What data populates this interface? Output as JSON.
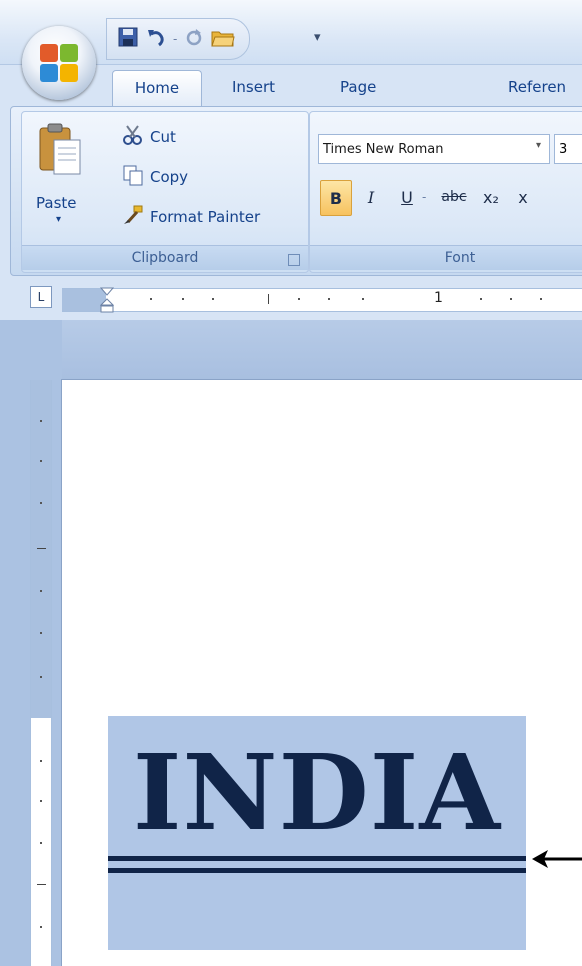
{
  "quick_access": {
    "icons": [
      "save-icon",
      "undo-icon",
      "redo-icon",
      "open-folder-icon"
    ],
    "customize_glyph": "▾"
  },
  "tabs": [
    {
      "label": "Home",
      "active": true
    },
    {
      "label": "Insert",
      "active": false
    },
    {
      "label": "Page Layout",
      "active": false
    },
    {
      "label": "Referen",
      "active": false
    }
  ],
  "clipboard": {
    "paste_label": "Paste",
    "cut_label": "Cut",
    "copy_label": "Copy",
    "format_painter_label": "Format Painter",
    "group_label": "Clipboard"
  },
  "font": {
    "font_name": "Times New Roman",
    "font_size": "3",
    "group_label": "Font",
    "buttons": [
      "B",
      "I",
      "U",
      "abc",
      "x₂",
      "x"
    ]
  },
  "ruler": {
    "number": "1",
    "tab_selector": "L"
  },
  "document": {
    "heading_text": "INDIA"
  },
  "colors": {
    "ribbon": "#d5e3f4",
    "text_dark": "#102448",
    "selection": "#b0c6e6",
    "tab_text": "#15428b"
  }
}
